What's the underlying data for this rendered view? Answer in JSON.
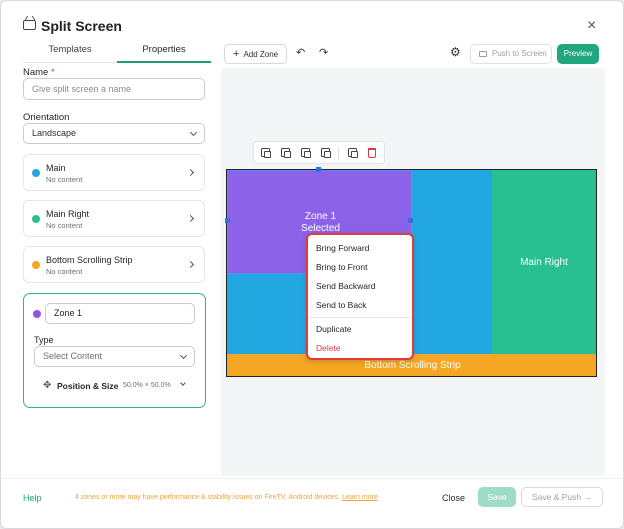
{
  "header": {
    "title": "Split Screen",
    "close_glyph": "×",
    "tv_icon": "tv-icon"
  },
  "tabs": [
    {
      "label": "Templates"
    },
    {
      "label": "Properties"
    }
  ],
  "form": {
    "name_label": "Name",
    "name_required_mark": "*",
    "name_placeholder": "Give split screen a name",
    "orientation_label": "Orientation",
    "orientation_value": "Landscape"
  },
  "zones": [
    {
      "name": "Main",
      "status": "No content",
      "color": "#23a7e1"
    },
    {
      "name": "Main Right",
      "status": "No content",
      "color": "#27c08e"
    },
    {
      "name": "Bottom Scrolling Strip",
      "status": "No content",
      "color": "#f5a623"
    }
  ],
  "zone_editor": {
    "zone_name": "Zone 1",
    "color": "#8a55e6",
    "type_label": "Type",
    "type_value": "Select Content",
    "position_label": "Position & Size",
    "position_value": "50.0% × 50.0%"
  },
  "toolbar": {
    "add_zone": "Add Zone",
    "push_label": "Push to Screen",
    "preview_label": "Preview",
    "accent": "#22a67d"
  },
  "layout": {
    "zone1_label": "Zone 1",
    "zone1_state": "Selected",
    "main_right_label": "Main Right",
    "strip_label": "Bottom Scrolling Strip"
  },
  "context_menu": {
    "items": [
      "Bring Forward",
      "Bring to Front",
      "Send Backward",
      "Send to Back",
      "Duplicate",
      "Delete"
    ],
    "danger_color": "#e0393e"
  },
  "footer": {
    "help": "Help",
    "warning": "4 zones or more may have performance & stability issues on FireTV, Android devices.",
    "learn_more": "Learn more",
    "close": "Close",
    "save": "Save",
    "save_push": "Save & Push"
  }
}
